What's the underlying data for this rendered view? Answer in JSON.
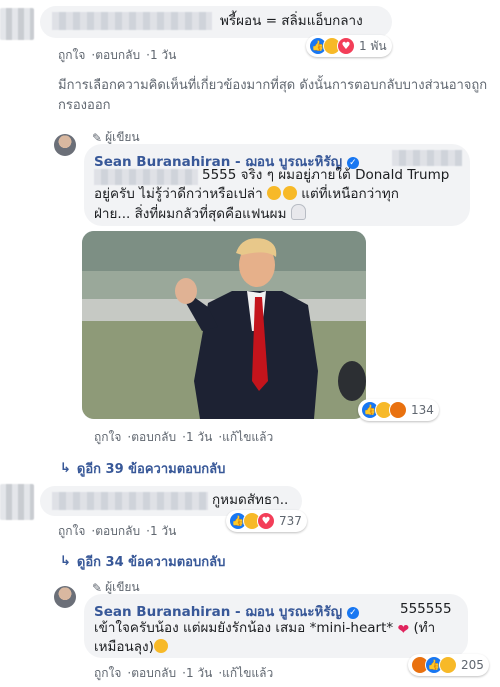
{
  "comment1": {
    "text": "พรี้ผอน = สลิ่มแอ็บกลาง",
    "reaction_count": "1 พัน",
    "actions": {
      "like": "ถูกใจ",
      "reply": "ตอบกลับ",
      "time": "1 วัน"
    }
  },
  "filter_notice": "มีการเลือกความคิดเห็นที่เกี่ยวข้องมากที่สุด ดังนั้นการตอบกลับบางส่วนอาจถูกกรองออก",
  "reply1": {
    "author_tag": "ผู้เขียน",
    "author": "Sean Buranahiran - ฌอน บูรณะหิรัญ",
    "text_prefix": "5555 จริง ๆ ผมอยู่ภายใต้ Donald Trump",
    "text_line2": "อยู่ครับ ไม่รู้ว่าดีกว่าหรือเปล่า",
    "text_line2_end": "แต่ที่เหนือกว่าทุก",
    "text_line3": "ฝ่าย... สิ่งที่ผมกลัวที่สุดคือแฟนผม",
    "reaction_count": "134",
    "actions": {
      "like": "ถูกใจ",
      "reply": "ตอบกลับ",
      "time": "1 วัน",
      "edited": "แก้ไขแล้ว"
    }
  },
  "more_replies1": "ดูอีก 39 ข้อความตอบกลับ",
  "comment2": {
    "text": "กูหมดสัทธา..",
    "reaction_count": "737",
    "actions": {
      "like": "ถูกใจ",
      "reply": "ตอบกลับ",
      "time": "1 วัน"
    }
  },
  "more_replies2": "ดูอีก 34 ข้อความตอบกลับ",
  "reply2": {
    "author_tag": "ผู้เขียน",
    "author": "Sean Buranahiran - ฌอน บูรณะหิรัญ",
    "text_suffix": "555555",
    "text_line2": "เข้าใจครับน้อง แต่ผมยังรักน้อง เสมอ *mini-heart*",
    "text_line2_end": "(ทำ",
    "text_line3": "เหมือนลุง)",
    "reaction_count": "205",
    "actions": {
      "like": "ถูกใจ",
      "reply": "ตอบกลับ",
      "time": "1 วัน",
      "edited": "แก้ไขแล้ว"
    }
  },
  "colors": {
    "link_blue": "#385898",
    "like_blue": "#1877f2",
    "meta_gray": "#606770",
    "bubble": "#f2f3f5"
  },
  "icons": [
    "pencil-icon",
    "verified-icon",
    "like-reaction-icon",
    "haha-reaction-icon",
    "love-reaction-icon",
    "angry-reaction-icon",
    "reply-arrow-icon"
  ]
}
